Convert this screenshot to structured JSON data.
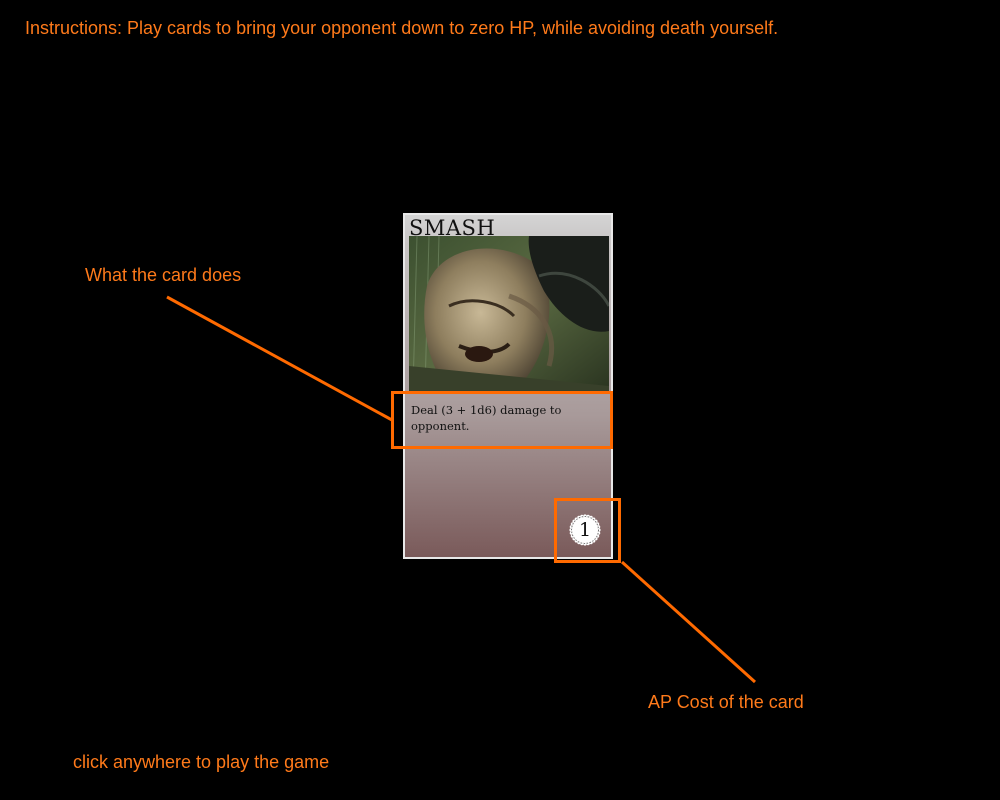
{
  "instructions": "Instructions: Play cards to bring your opponent down to zero HP, while avoiding death yourself.",
  "card": {
    "title": "SMASH",
    "description": "Deal (3 + 1d6) damage to opponent.",
    "ap_cost": "1",
    "art_icon": "card-art-image"
  },
  "annotations": {
    "effect_label": "What the card does",
    "cost_label": "AP Cost of the card"
  },
  "click_hint": "click anywhere to play the game",
  "colors": {
    "background": "#000000",
    "annotation": "#ff7a1a",
    "highlight": "#ff6a00"
  }
}
